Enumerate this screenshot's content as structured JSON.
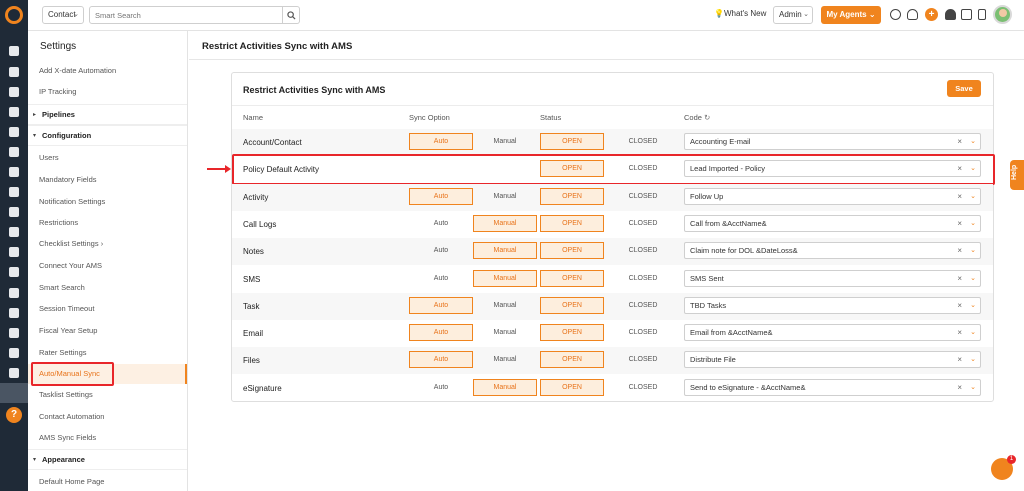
{
  "topbar": {
    "context_value": "Contact",
    "search_placeholder": "Smart Search",
    "whats_new": "What's New",
    "role_value": "Admin",
    "agents_label": "My Agents"
  },
  "sidebar": {
    "title": "Settings",
    "items_top": [
      "Add X-date Automation",
      "IP Tracking"
    ],
    "section_pipelines": "Pipelines",
    "section_configuration": "Configuration",
    "config_items": [
      "Users",
      "Mandatory Fields",
      "Notification Settings",
      "Restrictions",
      "Checklist Settings",
      "Connect Your AMS",
      "Smart Search",
      "Session Timeout",
      "Fiscal Year Setup",
      "Rater Settings",
      "Auto/Manual Sync",
      "Tasklist Settings",
      "Contact Automation",
      "AMS Sync Fields"
    ],
    "section_appearance": "Appearance",
    "appearance_items": [
      "Default Home Page"
    ]
  },
  "page": {
    "title": "Restrict Activities Sync with AMS",
    "card_title": "Restrict Activities Sync with AMS",
    "save_label": "Save"
  },
  "table": {
    "headers": [
      "Name",
      "Sync Option",
      "Status",
      "Code"
    ],
    "auto_label": "Auto",
    "manual_label": "Manual",
    "open_label": "OPEN",
    "closed_label": "CLOSED",
    "rows": [
      {
        "name": "Account/Contact",
        "sync": "auto",
        "status": "open",
        "code": "Accounting E-mail"
      },
      {
        "name": "Policy Default Activity",
        "sync": "none",
        "status": "open",
        "code": "Lead Imported - Policy"
      },
      {
        "name": "Activity",
        "sync": "auto",
        "status": "open",
        "code": "Follow Up"
      },
      {
        "name": "Call Logs",
        "sync": "manual",
        "status": "open",
        "code": "Call from &AcctName&"
      },
      {
        "name": "Notes",
        "sync": "manual",
        "status": "open",
        "code": "Claim note for DOL &DateLoss&"
      },
      {
        "name": "SMS",
        "sync": "manual",
        "status": "open",
        "code": "SMS Sent"
      },
      {
        "name": "Task",
        "sync": "auto",
        "status": "open",
        "code": "TBD Tasks"
      },
      {
        "name": "Email",
        "sync": "auto",
        "status": "open",
        "code": "Email from &AcctName&"
      },
      {
        "name": "Files",
        "sync": "auto",
        "status": "open",
        "code": "Distribute File"
      },
      {
        "name": "eSignature",
        "sync": "manual",
        "status": "open",
        "code": "Send to eSignature - &AcctName&"
      }
    ]
  },
  "help_label": "Help",
  "chat_badge": "1",
  "colors": {
    "accent": "#f0841e",
    "annotation": "#e8262a",
    "rail": "#1f2a37"
  }
}
